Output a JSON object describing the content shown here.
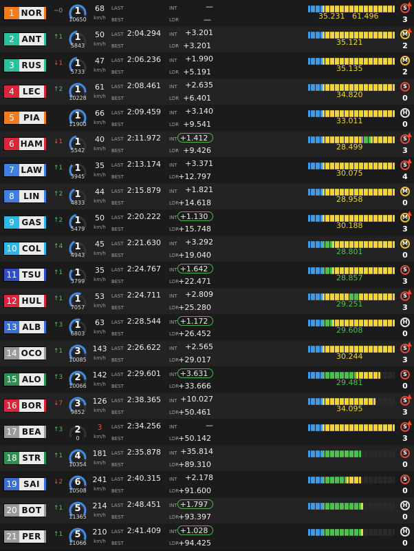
{
  "labels": {
    "last": "LAST",
    "best": "BEST",
    "int": "INT",
    "ldr": "LDR",
    "kmh": "km/h"
  },
  "colors": {
    "team_colors": {
      "NOR": "#f07c1e",
      "ANT": "#2bbf9b",
      "RUS": "#2bbf9b",
      "LEC": "#d9263a",
      "PIA": "#f07c1e",
      "HAM": "#d9263a",
      "LAW": "#3f7fe0",
      "LIN": "#3f7fe0",
      "GAS": "#2db7e8",
      "COL": "#2db7e8",
      "TSU": "#2f4fc9",
      "HUL": "#d9263a",
      "ALB": "#3a6fd6",
      "OCO": "#9a9a9a",
      "ALO": "#2e8f52",
      "BOR": "#d9263a",
      "BEA": "#9a9a9a",
      "STR": "#2e8f52",
      "SAI": "#3a6fd6",
      "BOT": "#9a9a9a",
      "PER": "#9a9a9a"
    },
    "pill_border": "#4db84d",
    "position_up": "#55c06a",
    "position_down": "#e25a48",
    "sector_yellow": "#f0d43a",
    "sector_green": "#4cc24c",
    "sector_purple": "#a97cf0",
    "sector_blue": "#3f9ae8",
    "sector_empty": "#2a2a2a"
  },
  "drivers": [
    {
      "pos": "1",
      "code": "NOR",
      "change": "−0",
      "gear": "1",
      "rpm": "10650",
      "speed": "68",
      "last": "",
      "int": "—",
      "int_pill": false,
      "ldr": "—",
      "s1": "35.231",
      "s2": "61.496",
      "s2_color": "#f0d43a",
      "tyre": "S",
      "tyre_flame": true,
      "stops": "3",
      "minis": "bbbbbbyyyyyyyyyyyyyyyyyyyyyyyyyyyyyy"
    },
    {
      "pos": "2",
      "code": "ANT",
      "change": "↑1",
      "gear": "1",
      "rpm": "5843",
      "speed": "50",
      "last": "2:04.294",
      "int": "+3.201",
      "int_pill": false,
      "ldr": "+3.201",
      "s1": "35.121",
      "s1_color": "#f0d43a",
      "tyre": "M",
      "tyre_flame": true,
      "stops": "2",
      "minis": "bbbbbbyyyyyyyyyyyyyyyyyyyyyyyyyyyyyy"
    },
    {
      "pos": "3",
      "code": "RUS",
      "change": "↓1",
      "gear": "1",
      "rpm": "5733",
      "speed": "47",
      "last": "2:06.236",
      "int": "+1.990",
      "int_pill": false,
      "ldr": "+5.191",
      "s1": "35.135",
      "s1_color": "#f0d43a",
      "tyre": "M",
      "tyre_flame": false,
      "stops": "2",
      "minis": "bbbbbbyyyyyyyyyyyyyyyyyyyyyyyyyyyyyy"
    },
    {
      "pos": "4",
      "code": "LEC",
      "change": "↑2",
      "gear": "1",
      "rpm": "10228",
      "speed": "61",
      "last": "2:08.461",
      "int": "+2.635",
      "int_pill": false,
      "ldr": "+6.401",
      "s1": "34.820",
      "s1_color": "#f0d43a",
      "tyre": "S",
      "tyre_flame": false,
      "stops": "0",
      "minis": "bbbbbbyyyyyyyyyyyyyyyyyyyyyyyyyyyyyy"
    },
    {
      "pos": "5",
      "code": "PIA",
      "change": "",
      "gear": "1",
      "rpm": "11900",
      "speed": "66",
      "last": "2:09.459",
      "int": "+3.140",
      "int_pill": false,
      "ldr": "+9.541",
      "s1": "33.011",
      "s1_color": "#f0d43a",
      "tyre": "H",
      "tyre_flame": false,
      "stops": "0",
      "minis": "bbbbbbyyyyyyyyyyyyyyyyyyyyyyyyyyyyyy"
    },
    {
      "pos": "6",
      "code": "HAM",
      "change": "↓1",
      "gear": "1",
      "rpm": "5542",
      "speed": "40",
      "last": "2:11.972",
      "int": "+1.412",
      "int_pill": true,
      "ldr": "+9.426",
      "s1": "28.499",
      "s1_color": "#f0d43a",
      "tyre": "S",
      "tyre_flame": true,
      "stops": "3",
      "minis": "bbbbbbyyyyyyyyyyyyyyyypgggyyyyyyyyyy"
    },
    {
      "pos": "7",
      "code": "LAW",
      "change": "↑1",
      "gear": "1",
      "rpm": "3945",
      "speed": "35",
      "last": "2:13.174",
      "int": "+3.371",
      "int_pill": false,
      "ldr": "+12.797",
      "s1": "30.075",
      "s1_color": "#f0d43a",
      "tyre": "S",
      "tyre_flame": true,
      "stops": "4",
      "minis": "bbbbbbyyyyyyyyyyyyyyyyyyyyyyyyyyyyyy"
    },
    {
      "pos": "8",
      "code": "LIN",
      "change": "↑2",
      "gear": "1",
      "rpm": "4833",
      "speed": "44",
      "last": "2:15.879",
      "int": "+1.821",
      "int_pill": false,
      "ldr": "+14.618",
      "s1": "28.958",
      "s1_color": "#f0d43a",
      "tyre": "M",
      "tyre_flame": false,
      "stops": "0",
      "minis": "bbbbbbyyyyyyyyyyyyyyyyyyyyyyyyyyyyyy"
    },
    {
      "pos": "9",
      "code": "GAS",
      "change": "↑2",
      "gear": "1",
      "rpm": "5479",
      "speed": "50",
      "last": "2:20.222",
      "int": "+1.130",
      "int_pill": true,
      "ldr": "+15.748",
      "s1": "30.188",
      "s1_color": "#f0d43a",
      "tyre": "M",
      "tyre_flame": true,
      "stops": "3",
      "minis": "bbbbbbyyyyyyyyyyyyyyyyyyyyyyyyyyyyyy"
    },
    {
      "pos": "10",
      "code": "COL",
      "change": "↑4",
      "gear": "1",
      "rpm": "4943",
      "speed": "45",
      "last": "2:21.630",
      "int": "+3.292",
      "int_pill": false,
      "ldr": "+19.040",
      "s1": "28.801",
      "s1_color": "#4cc24c",
      "tyre": "M",
      "tyre_flame": false,
      "stops": "0",
      "minis": "bbbbbbggggyyyyyyyyyyyyyyyyyyyyyyyyyy"
    },
    {
      "pos": "11",
      "code": "TSU",
      "change": "↑1",
      "gear": "1",
      "rpm": "3799",
      "speed": "35",
      "last": "2:24.767",
      "int": "+1.642",
      "int_pill": true,
      "ldr": "+22.471",
      "s1": "28.857",
      "s1_color": "#4cc24c",
      "tyre": "S",
      "tyre_flame": false,
      "stops": "3",
      "minis": "bbbbbbggggyyyyyyyyyyyyyyyyyyyyyyyyyy"
    },
    {
      "pos": "12",
      "code": "HUL",
      "change": "↑1",
      "gear": "1",
      "rpm": "7057",
      "speed": "53",
      "last": "2:24.711",
      "int": "+2.809",
      "int_pill": false,
      "ldr": "+25.280",
      "s1": "29.251",
      "s1_color": "#4cc24c",
      "tyre": "S",
      "tyre_flame": true,
      "stops": "3",
      "minis": "bbbbbbyyyyyyyyyyyggggyyyyyyyyyyyyyyy"
    },
    {
      "pos": "13",
      "code": "ALB",
      "change": "↑3",
      "gear": "1",
      "rpm": "6803",
      "speed": "63",
      "last": "2:28.544",
      "int": "+1.172",
      "int_pill": true,
      "ldr": "+26.452",
      "s1": "29.608",
      "s1_color": "#4cc24c",
      "tyre": "H",
      "tyre_flame": false,
      "stops": "0",
      "minis": "bbbbbbggggyyyyyyyyyyyyyyyyyyyyyyyyyy"
    },
    {
      "pos": "14",
      "code": "OCO",
      "change": "↑1",
      "gear": "3",
      "rpm": "10085",
      "speed": "143",
      "last": "2:26.622",
      "int": "+2.565",
      "int_pill": false,
      "ldr": "+29.017",
      "s1": "30.244",
      "s1_color": "#f0d43a",
      "tyre": "S",
      "tyre_flame": true,
      "stops": "3",
      "minis": "bbbbbbyyyyyyyyyyyyyyyyyyyyyyyyyyyyyy"
    },
    {
      "pos": "15",
      "code": "ALO",
      "change": "↑3",
      "gear": "2",
      "rpm": "10066",
      "speed": "142",
      "last": "2:29.601",
      "int": "+3.631",
      "int_pill": true,
      "ldr": "+33.666",
      "s1": "29.481",
      "s1_color": "#4cc24c",
      "tyre": "S",
      "tyre_flame": false,
      "stops": "0",
      "minis": "bbbbbbggggggggggggggyyyyyyyyyyeeeeee"
    },
    {
      "pos": "16",
      "code": "BOR",
      "change": "↓7",
      "gear": "3",
      "rpm": "9852",
      "speed": "126",
      "last": "2:38.365",
      "int": "+10.027",
      "int_pill": false,
      "ldr": "+50.461",
      "s1": "34.095",
      "s1_color": "#f0d43a",
      "tyre": "S",
      "tyre_flame": true,
      "stops": "3",
      "minis": "bbbbbbyyyyyyyyyyyyyyyyyyyyyyeeeeeeee"
    },
    {
      "pos": "17",
      "code": "BEA",
      "change": "↑3",
      "gear": "2",
      "rpm": "0",
      "speed": "3",
      "speed_red": true,
      "last": "2:34.256",
      "int": "—",
      "int_pill": false,
      "ldr": "+50.142",
      "s1": "",
      "tyre": "S",
      "tyre_flame": true,
      "stops": "3",
      "minis": "bbbbbbyyyyyyyyyyyyyyyyyyyyyyyyyyyyyy"
    },
    {
      "pos": "18",
      "code": "STR",
      "change": "↑1",
      "gear": "4",
      "rpm": "10354",
      "speed": "181",
      "last": "2:35.878",
      "int": "+35.814",
      "int_pill": false,
      "ldr": "+89.310",
      "s1": "",
      "tyre": "S",
      "tyre_flame": false,
      "stops": "0",
      "minis": "bbbbbbggggggggggggggggeeeeeeeeeeeeee"
    },
    {
      "pos": "19",
      "code": "SAI",
      "change": "↓2",
      "gear": "6",
      "rpm": "10508",
      "speed": "241",
      "last": "2:40.315",
      "int": "+2.178",
      "int_pill": false,
      "ldr": "+91.600",
      "s1": "",
      "tyre": "S",
      "tyre_flame": false,
      "stops": "0",
      "minis": "bbbbbbggggggggggyyyyyyeeeeeeeeeeeeee"
    },
    {
      "pos": "20",
      "code": "BOT",
      "change": "↑1",
      "gear": "5",
      "rpm": "11365",
      "speed": "214",
      "last": "2:48.451",
      "int": "+1.797",
      "int_pill": true,
      "ldr": "+93.397",
      "s1": "",
      "tyre": "H",
      "tyre_flame": false,
      "stops": "0",
      "minis": "bbbbbbggggggggggggggggyeeeeeeeeeeeee"
    },
    {
      "pos": "21",
      "code": "PER",
      "change": "↑1",
      "gear": "5",
      "rpm": "11066",
      "speed": "210",
      "last": "2:41.409",
      "int": "+1.028",
      "int_pill": true,
      "ldr": "+94.425",
      "s1": "",
      "tyre": "H",
      "tyre_flame": false,
      "stops": "0",
      "minis": "bbbbbbggggggggggggggggyeeeeeeeeeeeee"
    }
  ]
}
